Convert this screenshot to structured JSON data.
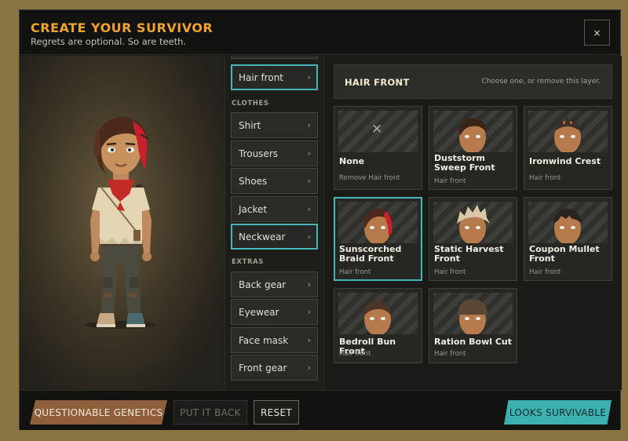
{
  "header": {
    "title": "CREATE YOUR SURVIVOR",
    "subtitle": "Regrets are optional. So are teeth.",
    "close_label": "×"
  },
  "categories": {
    "active": "Hair front",
    "top_item": "Hair front",
    "clothes_label": "CLOTHES",
    "clothes": [
      "Shirt",
      "Trousers",
      "Shoes",
      "Jacket",
      "Neckwear"
    ],
    "extras_label": "EXTRAS",
    "extras": [
      "Back gear",
      "Eyewear",
      "Face mask",
      "Front gear"
    ],
    "chevron": "›"
  },
  "options": {
    "title": "HAIR FRONT",
    "hint": "Choose one, or remove this layer.",
    "selected": "Sunscorched Braid Front",
    "cards": [
      {
        "name": "None",
        "sub": "Remove Hair front",
        "icon": "x-icon"
      },
      {
        "name": "Duststorm Sweep Front",
        "sub": "Hair front",
        "hair_color": "#3a2418"
      },
      {
        "name": "Ironwind Crest",
        "sub": "Hair front",
        "hair_color": "#3b2f28"
      },
      {
        "name": "Sunscorched Braid Front",
        "sub": "Hair front",
        "hair_color": "#4b2a1b"
      },
      {
        "name": "Static Harvest Front",
        "sub": "Hair front",
        "hair_color": "#d9c8a8"
      },
      {
        "name": "Coupon Mullet Front",
        "sub": "Hair front",
        "hair_color": "#2a2420"
      },
      {
        "name": "Bedroll Bun Front",
        "sub": "Hair front",
        "hair_color": "#4a3428"
      },
      {
        "name": "Ration Bowl Cut",
        "sub": "Hair front",
        "hair_color": "#5a4634"
      }
    ]
  },
  "footer": {
    "genetics": "QUESTIONABLE GENETICS",
    "put_back": "PUT IT BACK",
    "reset": "RESET",
    "survive": "LOOKS SURVIVABLE"
  },
  "colors": {
    "accent": "#f0a22c",
    "teal": "#3db0b2",
    "brown_button": "#8f5f3c",
    "hair_red": "#c8202c"
  }
}
